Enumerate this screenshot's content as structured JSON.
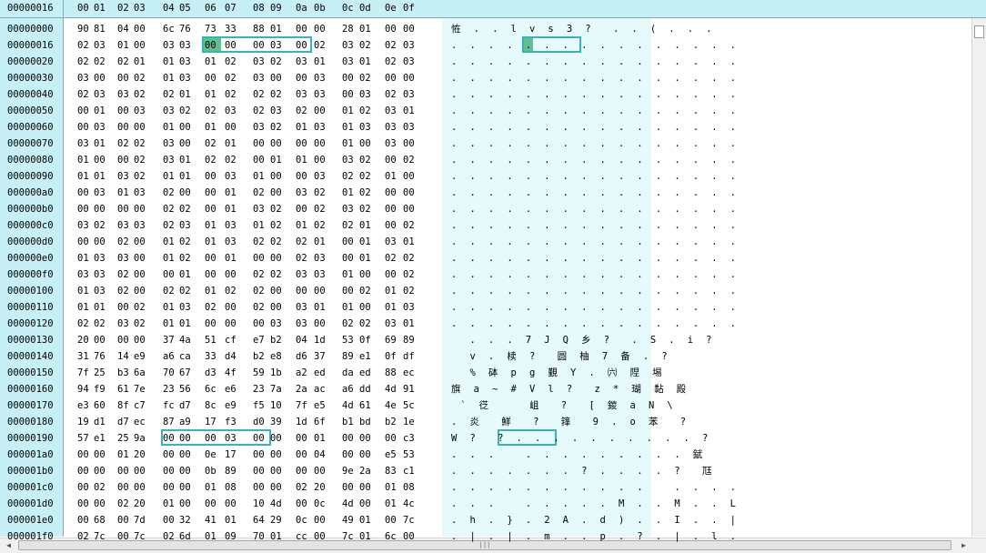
{
  "header": {
    "offset_label": "00000016",
    "columns": [
      "00",
      "01",
      "02",
      "03",
      "04",
      "05",
      "06",
      "07",
      "08",
      "09",
      "0a",
      "0b",
      "0c",
      "0d",
      "0e",
      "0f"
    ]
  },
  "rows": [
    {
      "offset": "00000000",
      "hex": [
        "90",
        "81",
        "04",
        "00",
        "6c",
        "76",
        "73",
        "33",
        "88",
        "01",
        "00",
        "00",
        "28",
        "01",
        "00",
        "00"
      ],
      "text": "恠 . . l v s 3 ?  . . ( . . ."
    },
    {
      "offset": "00000016",
      "hex": [
        "02",
        "03",
        "01",
        "00",
        "03",
        "03",
        "00",
        "00",
        "00",
        "03",
        "00",
        "02",
        "03",
        "02",
        "02",
        "03"
      ],
      "text": ". . . . . . . . . . . . . . . ."
    },
    {
      "offset": "00000020",
      "hex": [
        "02",
        "02",
        "02",
        "01",
        "01",
        "03",
        "01",
        "02",
        "03",
        "02",
        "03",
        "01",
        "03",
        "01",
        "02",
        "03"
      ],
      "text": ". . . . . . . . . . . . . . . ."
    },
    {
      "offset": "00000030",
      "hex": [
        "03",
        "00",
        "00",
        "02",
        "01",
        "03",
        "00",
        "02",
        "03",
        "00",
        "00",
        "03",
        "00",
        "02",
        "00",
        "00"
      ],
      "text": ". . . . . . . . . . . . . . . ."
    },
    {
      "offset": "00000040",
      "hex": [
        "02",
        "03",
        "03",
        "02",
        "02",
        "01",
        "01",
        "02",
        "02",
        "02",
        "03",
        "03",
        "00",
        "03",
        "02",
        "03"
      ],
      "text": ". . . . . . . . . . . . . . . ."
    },
    {
      "offset": "00000050",
      "hex": [
        "00",
        "01",
        "00",
        "03",
        "03",
        "02",
        "02",
        "03",
        "02",
        "03",
        "02",
        "00",
        "01",
        "02",
        "03",
        "01"
      ],
      "text": ". . . . . . . . . . . . . . . ."
    },
    {
      "offset": "00000060",
      "hex": [
        "00",
        "03",
        "00",
        "00",
        "01",
        "00",
        "01",
        "00",
        "03",
        "02",
        "01",
        "03",
        "01",
        "03",
        "03",
        "03"
      ],
      "text": ". . . . . . . . . . . . . . . ."
    },
    {
      "offset": "00000070",
      "hex": [
        "03",
        "01",
        "02",
        "02",
        "03",
        "00",
        "02",
        "01",
        "00",
        "00",
        "00",
        "00",
        "01",
        "00",
        "03",
        "00"
      ],
      "text": ". . . . . . . . . . . . . . . ."
    },
    {
      "offset": "00000080",
      "hex": [
        "01",
        "00",
        "00",
        "02",
        "03",
        "01",
        "02",
        "02",
        "00",
        "01",
        "01",
        "00",
        "03",
        "02",
        "00",
        "02"
      ],
      "text": ". . . . . . . . . . . . . . . ."
    },
    {
      "offset": "00000090",
      "hex": [
        "01",
        "01",
        "03",
        "02",
        "01",
        "01",
        "00",
        "03",
        "01",
        "00",
        "00",
        "03",
        "02",
        "02",
        "01",
        "00"
      ],
      "text": ". . . . . . . . . . . . . . . ."
    },
    {
      "offset": "000000a0",
      "hex": [
        "00",
        "03",
        "01",
        "03",
        "02",
        "00",
        "00",
        "01",
        "02",
        "00",
        "03",
        "02",
        "01",
        "02",
        "00",
        "00"
      ],
      "text": ". . . . . . . . . . . . . . . ."
    },
    {
      "offset": "000000b0",
      "hex": [
        "00",
        "00",
        "00",
        "00",
        "02",
        "02",
        "00",
        "01",
        "03",
        "02",
        "00",
        "02",
        "03",
        "02",
        "00",
        "00"
      ],
      "text": ". . . . . . . . . . . . . . . ."
    },
    {
      "offset": "000000c0",
      "hex": [
        "03",
        "02",
        "03",
        "03",
        "02",
        "03",
        "01",
        "03",
        "01",
        "02",
        "01",
        "02",
        "02",
        "01",
        "00",
        "02"
      ],
      "text": ". . . . . . . . . . . . . . . ."
    },
    {
      "offset": "000000d0",
      "hex": [
        "00",
        "00",
        "02",
        "00",
        "01",
        "02",
        "01",
        "03",
        "02",
        "02",
        "02",
        "01",
        "00",
        "01",
        "03",
        "01"
      ],
      "text": ". . . . . . . . . . . . . . . ."
    },
    {
      "offset": "000000e0",
      "hex": [
        "01",
        "03",
        "03",
        "00",
        "01",
        "02",
        "00",
        "01",
        "00",
        "00",
        "02",
        "03",
        "00",
        "01",
        "02",
        "02"
      ],
      "text": ". . . . . . . . . . . . . . . ."
    },
    {
      "offset": "000000f0",
      "hex": [
        "03",
        "03",
        "02",
        "00",
        "00",
        "01",
        "00",
        "00",
        "02",
        "02",
        "03",
        "03",
        "01",
        "00",
        "00",
        "02"
      ],
      "text": ". . . . . . . . . . . . . . . ."
    },
    {
      "offset": "00000100",
      "hex": [
        "01",
        "03",
        "02",
        "00",
        "02",
        "02",
        "01",
        "02",
        "02",
        "00",
        "00",
        "00",
        "00",
        "02",
        "01",
        "02"
      ],
      "text": ". . . . . . . . . . . . . . . ."
    },
    {
      "offset": "00000110",
      "hex": [
        "01",
        "01",
        "00",
        "02",
        "01",
        "03",
        "02",
        "00",
        "02",
        "00",
        "03",
        "01",
        "01",
        "00",
        "01",
        "03"
      ],
      "text": ". . . . . . . . . . . . . . . ."
    },
    {
      "offset": "00000120",
      "hex": [
        "02",
        "02",
        "03",
        "02",
        "01",
        "01",
        "00",
        "00",
        "00",
        "03",
        "03",
        "00",
        "02",
        "02",
        "03",
        "01"
      ],
      "text": ". . . . . . . . . . . . . . . ."
    },
    {
      "offset": "00000130",
      "hex": [
        "20",
        "00",
        "00",
        "00",
        "37",
        "4a",
        "51",
        "cf",
        "e7",
        "b2",
        "04",
        "1d",
        "53",
        "0f",
        "69",
        "89"
      ],
      "text": "  . . . 7 J Q 乡 ?  . S . i ?"
    },
    {
      "offset": "00000140",
      "hex": [
        "31",
        "76",
        "14",
        "e9",
        "a6",
        "ca",
        "33",
        "d4",
        "b2",
        "e8",
        "d6",
        "37",
        "89",
        "e1",
        "0f",
        "df"
      ],
      "text": "  v . 椟 ?  圆 柚 7 备 . ?"
    },
    {
      "offset": "00000150",
      "hex": [
        "7f",
        "25",
        "b3",
        "6a",
        "70",
        "67",
        "d3",
        "4f",
        "59",
        "1b",
        "a2",
        "ed",
        "da",
        "ed",
        "88",
        "ec"
      ],
      "text": "  % 砵 p g 覲 Y . ㈥ 陧 埸"
    },
    {
      "offset": "00000160",
      "hex": [
        "94",
        "f9",
        "61",
        "7e",
        "23",
        "56",
        "6c",
        "e6",
        "23",
        "7a",
        "2a",
        "ac",
        "a6",
        "dd",
        "4d",
        "91"
      ],
      "text": "旗 a ~ # V l ?  z * 瑚 黏 殿"
    },
    {
      "offset": "00000170",
      "hex": [
        "e3",
        "60",
        "8f",
        "c7",
        "fc",
        "d7",
        "8c",
        "e9",
        "f5",
        "10",
        "7f",
        "e5",
        "4d",
        "61",
        "4e",
        "5c"
      ],
      "text": " ` 徔    岨  ?  [ 鍐 a N \\"
    },
    {
      "offset": "00000180",
      "hex": [
        "19",
        "d1",
        "d7",
        "ec",
        "87",
        "a9",
        "17",
        "f3",
        "d0",
        "39",
        "1d",
        "6f",
        "b1",
        "bd",
        "b2",
        "1e"
      ],
      "text": ". 炎  鮮  ?  箨  9 . o 苯  ?"
    },
    {
      "offset": "00000190",
      "hex": [
        "57",
        "e1",
        "25",
        "9a",
        "00",
        "00",
        "00",
        "03",
        "00",
        "00",
        "00",
        "01",
        "00",
        "00",
        "00",
        "c3"
      ],
      "text": "W ?  ? . . . . . . . . . . ?"
    },
    {
      "offset": "000001a0",
      "hex": [
        "00",
        "00",
        "01",
        "20",
        "00",
        "00",
        "0e",
        "17",
        "00",
        "00",
        "00",
        "04",
        "00",
        "00",
        "e5",
        "53"
      ],
      "text": ". . .   . . . . . . . . . 錻"
    },
    {
      "offset": "000001b0",
      "hex": [
        "00",
        "00",
        "00",
        "00",
        "00",
        "00",
        "0b",
        "89",
        "00",
        "00",
        "00",
        "00",
        "9e",
        "2a",
        "83",
        "c1"
      ],
      "text": ". . . . . . . ? . . . . ?  尫"
    },
    {
      "offset": "000001c0",
      "hex": [
        "00",
        "02",
        "00",
        "00",
        "00",
        "00",
        "01",
        "08",
        "00",
        "00",
        "02",
        "20",
        "00",
        "00",
        "01",
        "08"
      ],
      "text": ". . . . . . . . . . .   . . . ."
    },
    {
      "offset": "000001d0",
      "hex": [
        "00",
        "00",
        "02",
        "20",
        "01",
        "00",
        "00",
        "00",
        "10",
        "4d",
        "00",
        "0c",
        "4d",
        "00",
        "01",
        "4c"
      ],
      "text": ". . .   . . . . . M . . M . . L"
    },
    {
      "offset": "000001e0",
      "hex": [
        "00",
        "68",
        "00",
        "7d",
        "00",
        "32",
        "41",
        "01",
        "64",
        "29",
        "0c",
        "00",
        "49",
        "01",
        "00",
        "7c"
      ],
      "text": ". h . } . 2 A . d ) . . I . . |"
    },
    {
      "offset": "000001f0",
      "hex": [
        "02",
        "7c",
        "00",
        "7c",
        "02",
        "6d",
        "01",
        "09",
        "70",
        "01",
        "cc",
        "00",
        "7c",
        "01",
        "6c",
        "00"
      ],
      "text": ". | . | . m . . p . ? . | . l ."
    }
  ],
  "scrollbar": {
    "horizontal_grip": "|||",
    "left_arrow": "◀",
    "right_arrow": "▶",
    "up_arrow": "▲",
    "down_arrow": "▼"
  },
  "colors": {
    "header_bg": "#c6f0f5",
    "text_pane_bg": "#e6fafc",
    "selection_green": "#5fbf8f",
    "selection_border": "#35b3c0"
  }
}
